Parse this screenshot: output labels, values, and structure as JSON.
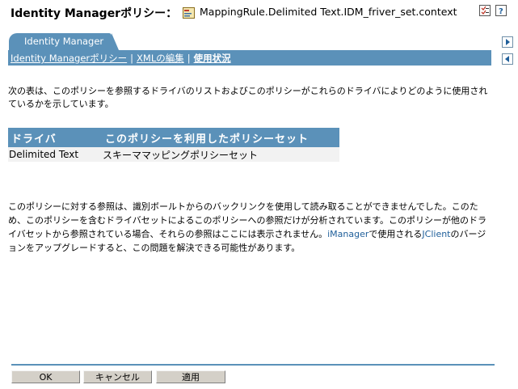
{
  "header": {
    "title": "Identity Managerポリシー：",
    "policy_name": "MappingRule.Delimited Text.IDM_friver_set.context"
  },
  "tab": {
    "label": "Identity Manager"
  },
  "breadcrumb": {
    "item1": "Identity Managerポリシー",
    "item2": "XMLの編集",
    "item3": "使用状況",
    "separator": "|"
  },
  "intro_text": "次の表は、このポリシーを参照するドライバのリストおよびこのポリシーがこれらのドライバによりどのように使用されているかを示しています。",
  "table": {
    "headers": [
      "ドライバ",
      "このポリシーを利用したポリシーセット"
    ],
    "rows": [
      [
        "Delimited Text",
        "スキーママッピングポリシーセット"
      ]
    ]
  },
  "note": {
    "text_before": "このポリシーに対する参照は、識別ボールトからのバックリンクを使用して読み取ることができませんでした。このため、このポリシーを含むドライバセットによるこのポリシーへの参照だけが分析されています。このポリシーが他のドライバセットから参照されている場合、それらの参照はここには表示されません。",
    "highlight": "iManager",
    "text_middle": "で使用される",
    "highlight2": "JClient",
    "text_after": "のバージョンをアップグレードすると、この問題を解決できる可能性があります。"
  },
  "buttons": {
    "ok": "OK",
    "cancel": "キャンセル",
    "apply": "適用"
  },
  "colors": {
    "accent": "#5b91b9",
    "table_row_bg": "#f2f2f2",
    "link_highlight": "#1f5f9a"
  },
  "icons": {
    "policy": "policy-icon",
    "header_left": "checklist-icon",
    "header_right": "help-icon",
    "nav_forward": "arrow-right-icon",
    "nav_back": "arrow-left-icon"
  }
}
